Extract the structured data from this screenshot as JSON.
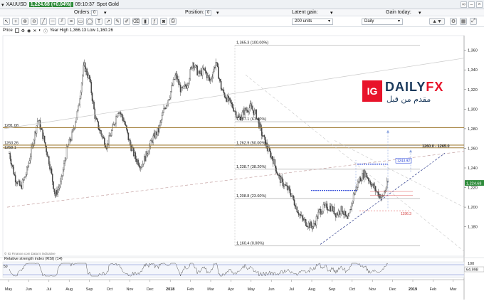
{
  "window": {
    "symbol": "XAUUSD",
    "price_badge": "1,224.68 (+0.04%)",
    "time": "09:10:37",
    "instrument": "Spot Gold"
  },
  "trade_bar": {
    "orders_label": "Orders:",
    "orders_value": "0",
    "position_label": "Position:",
    "position_value": "0",
    "latent_gain_label": "Latent gain:",
    "gain_today_label": "Gain today:"
  },
  "toolbar": {
    "units": "200 units",
    "timeframe": "Daily"
  },
  "info": {
    "price_label": "Price",
    "year_stats": "Year High 1,366.13 Low 1,160.26"
  },
  "chart_data": {
    "type": "candlestick",
    "symbol": "XAUUSD",
    "y_ticks": [
      1180,
      1200,
      1220,
      1240,
      1260,
      1280,
      1300,
      1320,
      1340,
      1360
    ],
    "ylim": [
      1150,
      1375
    ],
    "x_labels": [
      "May",
      "Jun",
      "Jul",
      "Aug",
      "Sep",
      "Oct",
      "Nov",
      "Dec",
      "2018",
      "Feb",
      "Mar",
      "Apr",
      "May",
      "Jun",
      "Jul",
      "Aug",
      "Sep",
      "Oct",
      "Nov",
      "Dec",
      "2019",
      "Feb",
      "Mar"
    ],
    "price_path": [
      1255,
      1230,
      1220,
      1235,
      1262,
      1290,
      1270,
      1245,
      1212,
      1225,
      1258,
      1275,
      1300,
      1345,
      1330,
      1290,
      1275,
      1262,
      1280,
      1300,
      1288,
      1265,
      1250,
      1242,
      1255,
      1270,
      1278,
      1300,
      1315,
      1335,
      1318,
      1325,
      1348,
      1335,
      1340,
      1328,
      1348,
      1320,
      1310,
      1302,
      1290,
      1298,
      1302,
      1295,
      1275,
      1260,
      1248,
      1230,
      1222,
      1215,
      1200,
      1188,
      1183,
      1180,
      1195,
      1200,
      1200,
      1193,
      1198,
      1185,
      1212,
      1228,
      1235,
      1225,
      1216,
      1209,
      1225
    ],
    "last_price": "1,224.68",
    "fib_levels": [
      {
        "label": "1,365.3 (100.00%)",
        "value": 1365.3
      },
      {
        "label": "1,287.1 (61.80%)",
        "value": 1287.1
      },
      {
        "label": "1,262.9 (50.00%)",
        "value": 1262.9
      },
      {
        "label": "1,238.7 (38.20%)",
        "value": 1238.7
      },
      {
        "label": "1,208.8 (23.60%)",
        "value": 1208.8
      },
      {
        "label": "1,160.4 (0.00%)",
        "value": 1160.4
      }
    ],
    "horizontal_labels": [
      {
        "label": "1281.08",
        "value": 1281.08
      },
      {
        "label": "1263.26",
        "value": 1263.26
      },
      {
        "label": "1258.1",
        "value": 1260.5
      }
    ],
    "zone_label": "1260.0 - 1265.0",
    "target_label": "1243.92",
    "stop_label": "1196.3",
    "source_note": "© IG Finance.com Data is indicative",
    "rsi": {
      "title": "Relative strength index (RSI) (14)",
      "upper_value": "100",
      "value": "64.998",
      "left_label": "50"
    },
    "colors": {
      "candle": "#444444",
      "level_line": "#a07c35",
      "fib_line": "#9a9a9a",
      "trend_dashed": "#c6a4a4",
      "target_dotted": "#1e3ad6",
      "price_badge": "#2e8b3a"
    }
  },
  "logo": {
    "ig": "IG",
    "name_part1": "DAILY",
    "name_part2": "FX",
    "tagline": "مقدم من قبل"
  }
}
